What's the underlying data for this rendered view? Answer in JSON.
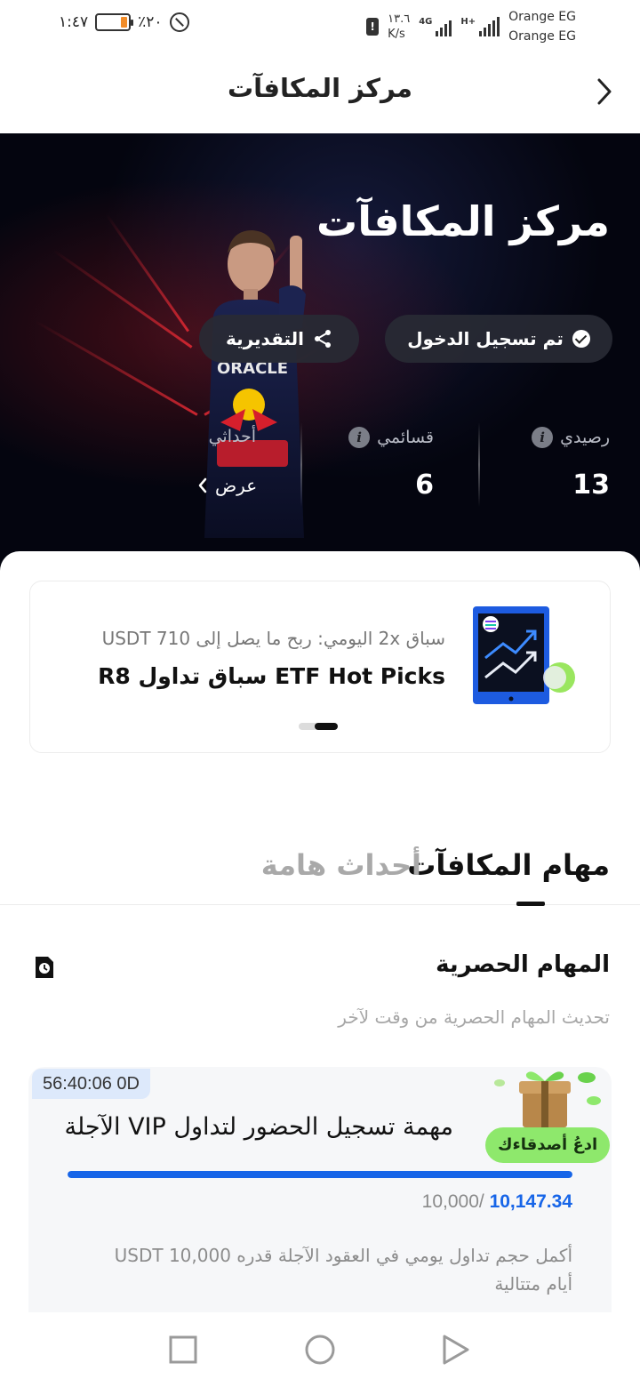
{
  "status_bar": {
    "time": "١:٤٧",
    "battery": "٪٢٠",
    "battery_level": 0.2,
    "speed": "١٣.٦",
    "speed_unit": "K/s",
    "network_4g": "4G",
    "network_h": "H+",
    "carrier_1": "Orange EG",
    "carrier_2": "Orange EG"
  },
  "header": {
    "title": "مركز المكافآت",
    "back_icon": "chevron-right-icon"
  },
  "hero": {
    "title": "مركز المكافآت",
    "signed_in_label": "تم تسجيل الدخول",
    "share_label": "التقديرية",
    "stats": {
      "balance_label": "رصيدي",
      "balance_value": "13",
      "coupons_label": "قسائمي",
      "coupons_value": "6",
      "events_label": "أحداثي",
      "view_label": "عرض"
    },
    "sponsor_text": "ORACLE"
  },
  "promo": {
    "subtitle": "سباق 2x اليومي: ربح ما يصل إلى USDT 710",
    "title": "ETF Hot Picks سباق تداول R8"
  },
  "tabs": {
    "active": "مهام المكافآت",
    "inactive": "أحداث هامة"
  },
  "section": {
    "title": "المهام الحصرية",
    "subtitle": "تحديث المهام الحصرية من وقت لآخر"
  },
  "task": {
    "timer": "56:40:06 0D",
    "badge": "ادعُ أصدقاءك",
    "title": "مهمة تسجيل الحضور لتداول VIP الآجلة",
    "progress": 1.0,
    "current_amount": "10,147.34",
    "target_amount": "10,000/",
    "description": "أكمل حجم تداول يومي في العقود الآجلة قدره 10,000 USDT أيام متتالية"
  },
  "colors": {
    "accent_blue": "#1765e8",
    "hero_bg": "#04050f",
    "badge_green": "#8ee86c",
    "battery_orange": "#f28c28"
  }
}
